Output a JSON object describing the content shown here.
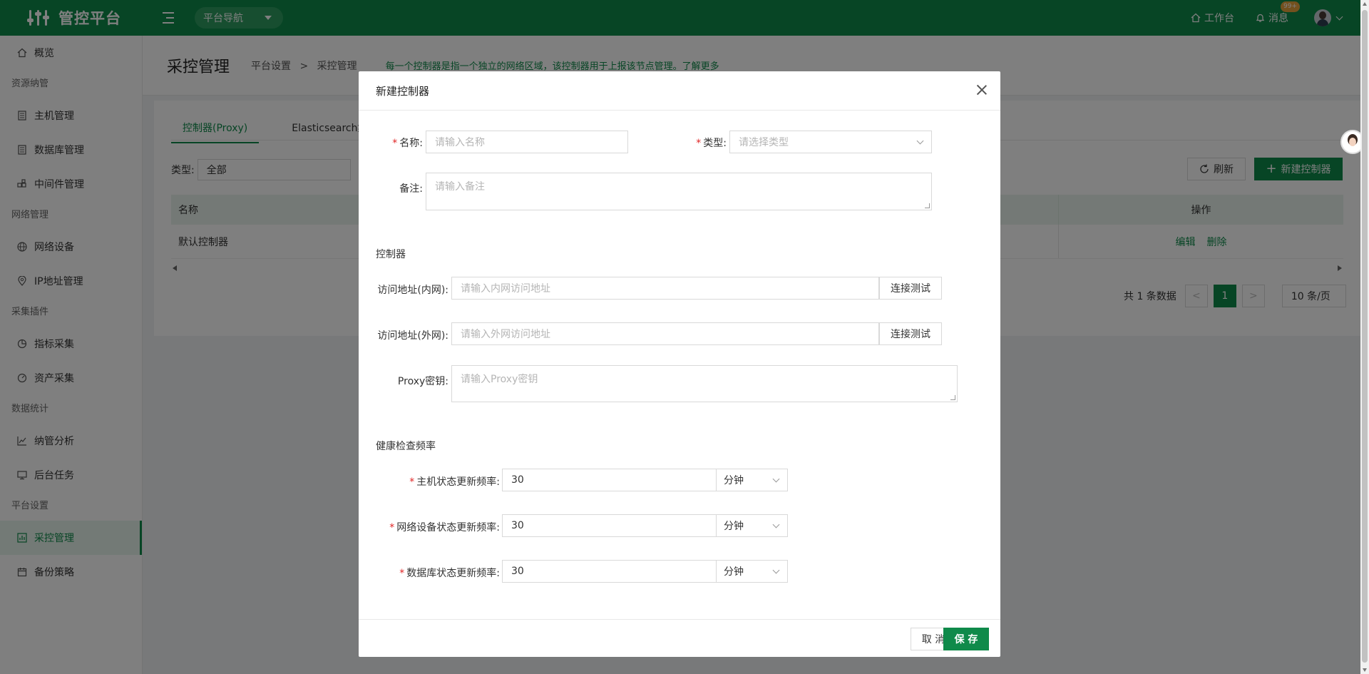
{
  "app": {
    "title": "管控平台",
    "nav_pill": "平台导航",
    "workbench": "工作台",
    "messages": "消息",
    "message_badge": "99+"
  },
  "sidebar": {
    "overview": "概览",
    "groups": [
      {
        "title": "资源纳管",
        "items": [
          "主机管理",
          "数据库管理",
          "中间件管理"
        ]
      },
      {
        "title": "网络管理",
        "items": [
          "网络设备",
          "IP地址管理"
        ]
      },
      {
        "title": "采集插件",
        "items": [
          "指标采集",
          "资产采集"
        ]
      },
      {
        "title": "数据统计",
        "items": [
          "纳管分析",
          "后台任务"
        ]
      },
      {
        "title": "平台设置",
        "items": [
          "采控管理",
          "备份策略"
        ]
      }
    ],
    "active": "采控管理"
  },
  "page": {
    "title": "采控管理",
    "breadcrumb": [
      "平台设置",
      "采控管理"
    ],
    "hint": "每一个控制器是指一个独立的网络区域，该控制器用于上报该节点管理。了解更多",
    "tabs": [
      "控制器(Proxy)",
      "Elasticsearch集"
    ],
    "filter_label": "类型:",
    "filter_value": "全部",
    "refresh": "刷新",
    "new_controller": "新建控制器",
    "table": {
      "headers": [
        "名称",
        "操作"
      ],
      "rows": [
        {
          "name": "默认控制器",
          "actions": [
            "编辑",
            "删除"
          ]
        }
      ]
    },
    "pager": {
      "total": "共 1 条数据",
      "current": "1",
      "size": "10 条/页"
    }
  },
  "modal": {
    "title": "新建控制器",
    "name_label": "名称:",
    "name_placeholder": "请输入名称",
    "type_label": "类型:",
    "type_placeholder": "请选择类型",
    "remark_label": "备注:",
    "remark_placeholder": "请输入备注",
    "section_controller": "控制器",
    "intranet_label": "访问地址(内网):",
    "intranet_placeholder": "请输入内网访问地址",
    "extranet_label": "访问地址(外网):",
    "extranet_placeholder": "请输入外网访问地址",
    "test_button": "连接测试",
    "proxy_key_label": "Proxy密钥:",
    "proxy_key_placeholder": "请输入Proxy密钥",
    "section_health": "健康检查频率",
    "host_freq_label": "主机状态更新频率:",
    "host_freq_value": "30",
    "net_freq_label": "网络设备状态更新频率:",
    "net_freq_value": "30",
    "db_freq_label": "数据库状态更新频率:",
    "db_freq_value": "30",
    "unit": "分钟",
    "cancel": "取 消",
    "save": "保 存"
  }
}
